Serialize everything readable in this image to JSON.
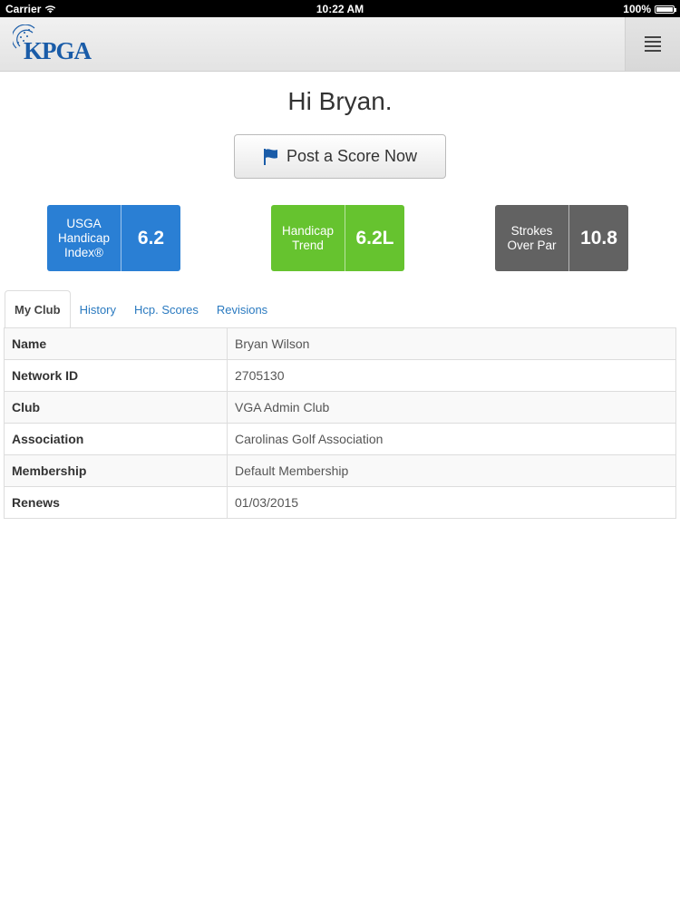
{
  "status_bar": {
    "carrier": "Carrier",
    "time": "10:22 AM",
    "battery": "100%"
  },
  "header": {
    "logo_text": "KPGA",
    "menu_icon": "hamburger-menu-icon"
  },
  "greeting": "Hi Bryan.",
  "post_button": {
    "label": "Post a Score Now",
    "icon": "flag-icon"
  },
  "stats": [
    {
      "label": "USGA Handicap Index®",
      "value": "6.2",
      "color": "#2a7fd4"
    },
    {
      "label": "Handicap Trend",
      "value": "6.2L",
      "color": "#66c32f"
    },
    {
      "label": "Strokes Over Par",
      "value": "10.8",
      "color": "#626262"
    }
  ],
  "tabs": [
    {
      "label": "My Club",
      "active": true
    },
    {
      "label": "History"
    },
    {
      "label": "Hcp. Scores"
    },
    {
      "label": "Revisions"
    }
  ],
  "table": [
    {
      "key": "Name",
      "value": "Bryan Wilson"
    },
    {
      "key": "Network ID",
      "value": "2705130"
    },
    {
      "key": "Club",
      "value": "VGA Admin Club"
    },
    {
      "key": "Association",
      "value": "Carolinas Golf Association"
    },
    {
      "key": "Membership",
      "value": "Default Membership"
    },
    {
      "key": "Renews",
      "value": "01/03/2015"
    }
  ]
}
